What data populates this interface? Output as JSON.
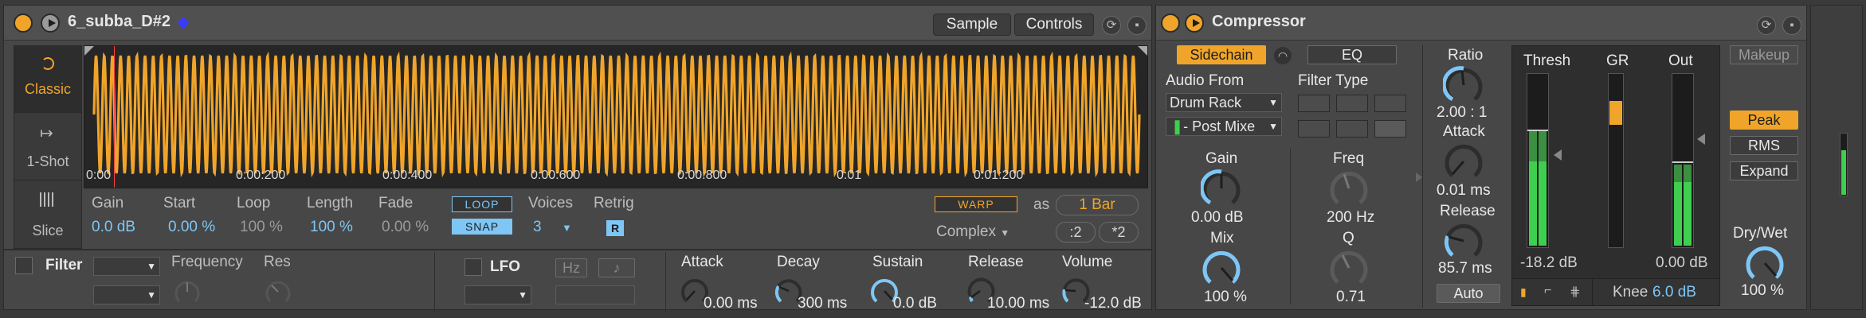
{
  "simpler": {
    "title": "6_subba_D#2",
    "tabs": [
      "Sample",
      "Controls"
    ],
    "modes": [
      {
        "label": "Classic",
        "icon": "loop-arrow-icon",
        "active": true
      },
      {
        "label": "1-Shot",
        "icon": "one-shot-arrow-icon",
        "active": false
      },
      {
        "label": "Slice",
        "icon": "slice-bars-icon",
        "active": false
      }
    ],
    "ruler": [
      "0:00",
      "0:00:200",
      "0:00:400",
      "0:00:600",
      "0:00:800",
      "0:01",
      "0:01:200"
    ],
    "params": {
      "gain": {
        "label": "Gain",
        "value": "0.0 dB"
      },
      "start": {
        "label": "Start",
        "value": "0.00 %"
      },
      "loop": {
        "label": "Loop",
        "value": "100 %"
      },
      "length": {
        "label": "Length",
        "value": "100 %"
      },
      "fade": {
        "label": "Fade",
        "value": "0.00 %"
      },
      "loop_btn": "LOOP",
      "snap_btn": "SNAP",
      "voices": {
        "label": "Voices",
        "value": "3"
      },
      "retrig": {
        "label": "Retrig",
        "value": "R"
      },
      "warp": "WARP",
      "as_label": "as",
      "bars": "1 Bar",
      "warp_mode": "Complex",
      "div2": ":2",
      "mul2": "*2"
    },
    "bottom": {
      "filter_label": "Filter",
      "frequency_label": "Frequency",
      "res_label": "Res",
      "lfo_label": "LFO",
      "hz_label": "Hz",
      "note_icon": "♪",
      "attack": {
        "label": "Attack",
        "value": "0.00 ms"
      },
      "decay": {
        "label": "Decay",
        "value": "300 ms"
      },
      "sustain": {
        "label": "Sustain",
        "value": "0.0 dB"
      },
      "release": {
        "label": "Release",
        "value": "10.00 ms"
      },
      "volume": {
        "label": "Volume",
        "value": "-12.0 dB"
      }
    }
  },
  "compressor": {
    "title": "Compressor",
    "sidechain": "Sidechain",
    "eq": "EQ",
    "audio_from_label": "Audio From",
    "audio_from": "Drum Rack",
    "post_mixer": "- Post Mixe",
    "filter_type_label": "Filter Type",
    "gain": {
      "label": "Gain",
      "value": "0.00 dB"
    },
    "mix": {
      "label": "Mix",
      "value": "100 %"
    },
    "freq": {
      "label": "Freq",
      "value": "200 Hz"
    },
    "q": {
      "label": "Q",
      "value": "0.71"
    },
    "ratio": {
      "label": "Ratio",
      "value": "2.00 : 1"
    },
    "attack": {
      "label": "Attack",
      "value": "0.01 ms"
    },
    "release": {
      "label": "Release",
      "value": "85.7 ms"
    },
    "auto": "Auto",
    "thresh_label": "Thresh",
    "gr_label": "GR",
    "out_label": "Out",
    "thresh_value": "-18.2 dB",
    "out_value": "0.00 dB",
    "knee_label": "Knee",
    "knee_value": "6.0 dB",
    "makeup": "Makeup",
    "peak": "Peak",
    "rms": "RMS",
    "expand": "Expand",
    "drywet": {
      "label": "Dry/Wet",
      "value": "100 %"
    }
  },
  "colors": {
    "accent": "#f0a52a",
    "value_blue": "#7ec6f5",
    "meter_green": "#3fcf4e",
    "bg": "#474747"
  }
}
